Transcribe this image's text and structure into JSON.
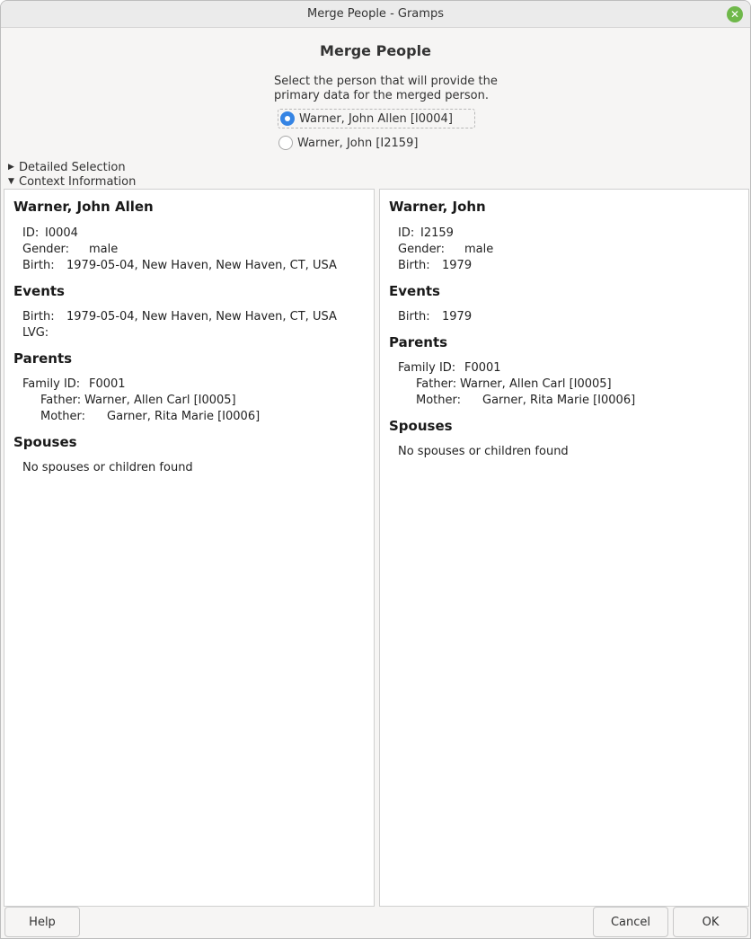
{
  "window": {
    "title": "Merge People - Gramps"
  },
  "dialog": {
    "heading": "Merge People",
    "instructions": "Select the person that will provide the primary data for the merged person."
  },
  "options": [
    {
      "label": "Warner, John Allen [I0004]",
      "selected": true
    },
    {
      "label": "Warner, John [I2159]",
      "selected": false
    }
  ],
  "expanders": {
    "detailed": "Detailed Selection",
    "context": "Context Information"
  },
  "left": {
    "name": "Warner, John Allen",
    "id_label": "ID:",
    "id": "I0004",
    "gender_label": "Gender:",
    "gender": "male",
    "birth_label": "Birth:",
    "birth": "1979-05-04, New Haven, New Haven, CT, USA",
    "events_heading": "Events",
    "event_birth_label": "Birth:",
    "event_birth": "1979-05-04, New Haven, New Haven, CT, USA",
    "event_lvg_label": "LVG:",
    "parents_heading": "Parents",
    "family_label": "Family ID:",
    "family_id": "F0001",
    "father_label": "Father:",
    "father": "Warner, Allen Carl [I0005]",
    "mother_label": "Mother:",
    "mother": "Garner, Rita Marie [I0006]",
    "spouses_heading": "Spouses",
    "spouses_text": "No spouses or children found"
  },
  "right": {
    "name": "Warner, John",
    "id_label": "ID:",
    "id": "I2159",
    "gender_label": "Gender:",
    "gender": "male",
    "birth_label": "Birth:",
    "birth": "1979",
    "events_heading": "Events",
    "event_birth_label": "Birth:",
    "event_birth": "1979",
    "parents_heading": "Parents",
    "family_label": "Family ID:",
    "family_id": "F0001",
    "father_label": "Father:",
    "father": "Warner, Allen Carl [I0005]",
    "mother_label": "Mother:",
    "mother": "Garner, Rita Marie [I0006]",
    "spouses_heading": "Spouses",
    "spouses_text": "No spouses or children found"
  },
  "buttons": {
    "help": "Help",
    "cancel": "Cancel",
    "ok": "OK"
  },
  "colors": {
    "accent": "#3584e4",
    "close": "#6fb84a"
  },
  "icons": {
    "close": "close-icon",
    "expander_collapsed": "triangle-right-icon",
    "expander_expanded": "triangle-down-icon"
  }
}
